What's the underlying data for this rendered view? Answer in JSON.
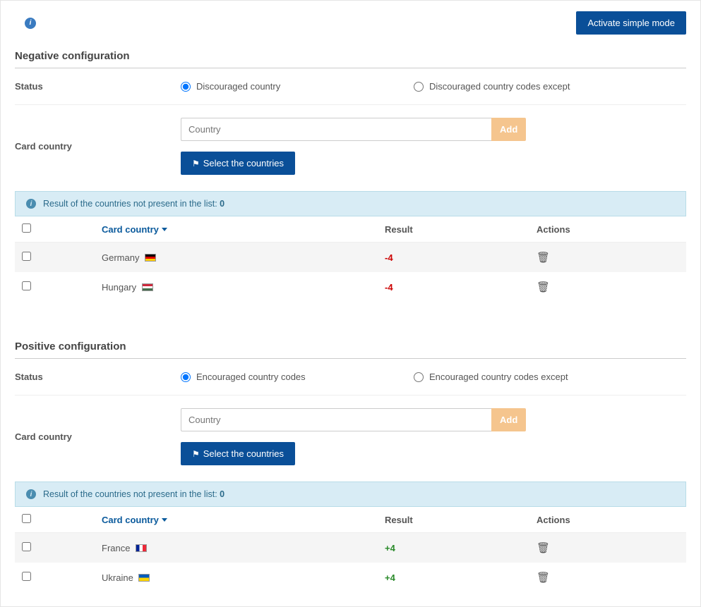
{
  "toolbar": {
    "activate_label": "Activate simple mode"
  },
  "negative": {
    "title": "Negative configuration",
    "status_label": "Status",
    "radio1": "Discouraged country",
    "radio2": "Discouraged country codes except",
    "card_country_label": "Card country",
    "country_placeholder": "Country",
    "add_label": "Add",
    "select_label": "Select the countries",
    "result_text": "Result of the countries not present in the list:",
    "result_value": "0",
    "columns": {
      "card": "Card country",
      "result": "Result",
      "actions": "Actions"
    },
    "rows": [
      {
        "country": "Germany",
        "flag": "de",
        "result": "-4"
      },
      {
        "country": "Hungary",
        "flag": "hu",
        "result": "-4"
      }
    ]
  },
  "positive": {
    "title": "Positive configuration",
    "status_label": "Status",
    "radio1": "Encouraged country codes",
    "radio2": "Encouraged country codes except",
    "card_country_label": "Card country",
    "country_placeholder": "Country",
    "add_label": "Add",
    "select_label": "Select the countries",
    "result_text": "Result of the countries not present in the list:",
    "result_value": "0",
    "columns": {
      "card": "Card country",
      "result": "Result",
      "actions": "Actions"
    },
    "rows": [
      {
        "country": "France",
        "flag": "fr",
        "result": "+4"
      },
      {
        "country": "Ukraine",
        "flag": "ua",
        "result": "+4"
      }
    ]
  }
}
